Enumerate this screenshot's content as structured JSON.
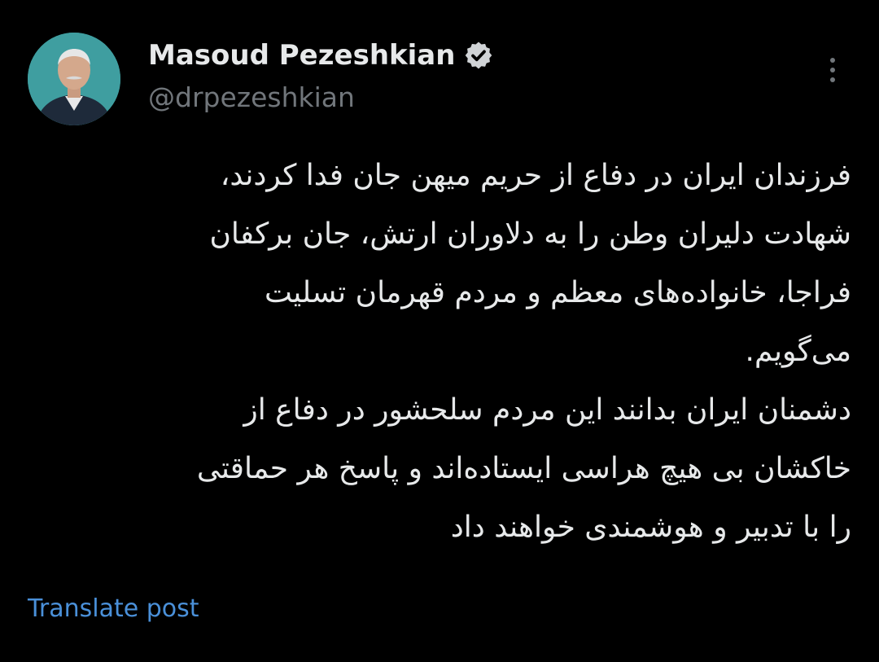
{
  "author": {
    "display_name": "Masoud Pezeshkian",
    "handle": "@drpezeshkian",
    "verified": true,
    "avatar_icon": "profile-photo-avatar"
  },
  "icons": {
    "verified": "verified-badge-icon",
    "more": "more-options-icon"
  },
  "post": {
    "lines": [
      "فرزندان ایران در دفاع از حریم میهن جان فدا کردند،",
      "شهادت دلیران وطن را به دلاوران ارتش، جان برکفان",
      "فراجا، خانواده‌های معظم و مردم قهرمان تسلیت",
      "می‌گویم.",
      "دشمنان ایران بدانند این مردم سلحشور در دفاع از",
      "خاکشان بی هیچ هراسی ایستاده‌اند و پاسخ هر حماقتی",
      "را با تدبیر و هوشمندی خواهند داد"
    ]
  },
  "actions": {
    "translate_label": "Translate post"
  },
  "colors": {
    "background": "#000000",
    "primary_text": "#e7e9ea",
    "secondary_text": "#71767b",
    "link": "#4a90d9",
    "avatar_bg": "#3f9ea0"
  }
}
